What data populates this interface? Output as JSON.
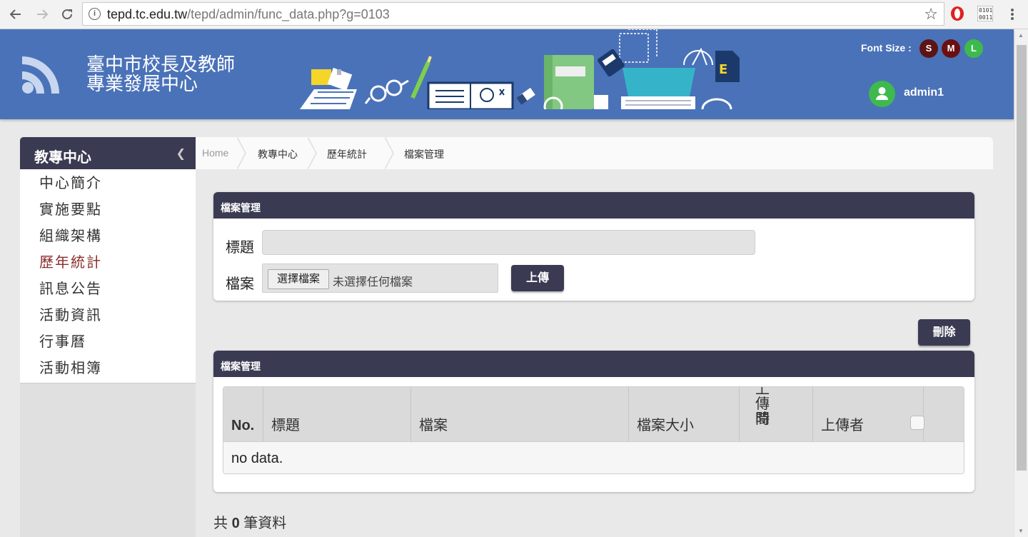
{
  "browser": {
    "url_host": "tepd.tc.edu.tw",
    "url_path": "/tepd/admin/func_data.php?g=0103",
    "ext_label": "0101\n0011"
  },
  "header": {
    "site_title_line1": "臺中市校長及教師",
    "site_title_line2": "專業發展中心",
    "font_size_label": "Font Size :",
    "font_buttons": [
      {
        "label": "S",
        "color": "#5c1414"
      },
      {
        "label": "M",
        "color": "#6a1010"
      },
      {
        "label": "L",
        "color": "#3eb94e"
      }
    ],
    "username": "admin1"
  },
  "sidebar": {
    "title": "教專中心",
    "items": [
      {
        "label": "中心簡介"
      },
      {
        "label": "實施要點"
      },
      {
        "label": "組織架構"
      },
      {
        "label": "歷年統計",
        "active": true
      },
      {
        "label": "訊息公告"
      },
      {
        "label": "活動資訊"
      },
      {
        "label": "行事曆"
      },
      {
        "label": "活動相簿"
      }
    ]
  },
  "breadcrumb": [
    "Home",
    "教專中心",
    "歷年統計",
    "檔案管理"
  ],
  "upload_panel": {
    "title": "檔案管理",
    "title_label": "標題",
    "file_label": "檔案",
    "choose_file": "選擇檔案",
    "no_file": "未選擇任何檔案",
    "upload_button": "上傳"
  },
  "delete_button": "刪除",
  "list_panel": {
    "title": "檔案管理",
    "columns": [
      "No.",
      "標題",
      "檔案",
      "檔案大小",
      "上傳時間",
      "上傳者"
    ],
    "time_col_line1": "上傳時",
    "time_col_line2": "間",
    "empty_text": "no data."
  },
  "total": {
    "prefix": "共",
    "count": "0",
    "suffix": "筆資料"
  }
}
